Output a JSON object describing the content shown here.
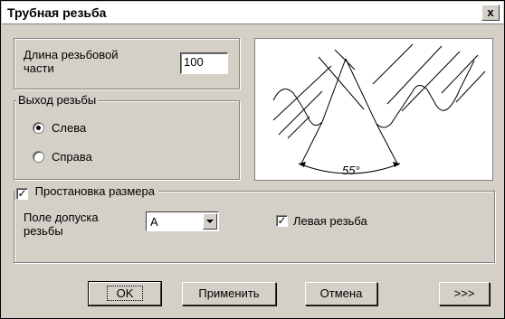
{
  "window": {
    "title": "Трубная резьба",
    "close_label": "x"
  },
  "length": {
    "label": "Длина резьбовой части",
    "value": "100"
  },
  "exit_group": {
    "caption": "Выход резьбы",
    "options": [
      {
        "label": "Слева",
        "checked": true
      },
      {
        "label": "Справа",
        "checked": false
      }
    ]
  },
  "drawing": {
    "angle_label": "55°"
  },
  "dimension": {
    "checkbox_label": "Простановка размера",
    "checked": true,
    "tolerance_label": "Поле допуска резьбы",
    "tolerance_value": "A",
    "left_thread_label": "Левая резьба",
    "left_thread_checked": true
  },
  "buttons": {
    "ok": "OK",
    "apply": "Применить",
    "cancel": "Отмена",
    "more": ">>>"
  }
}
